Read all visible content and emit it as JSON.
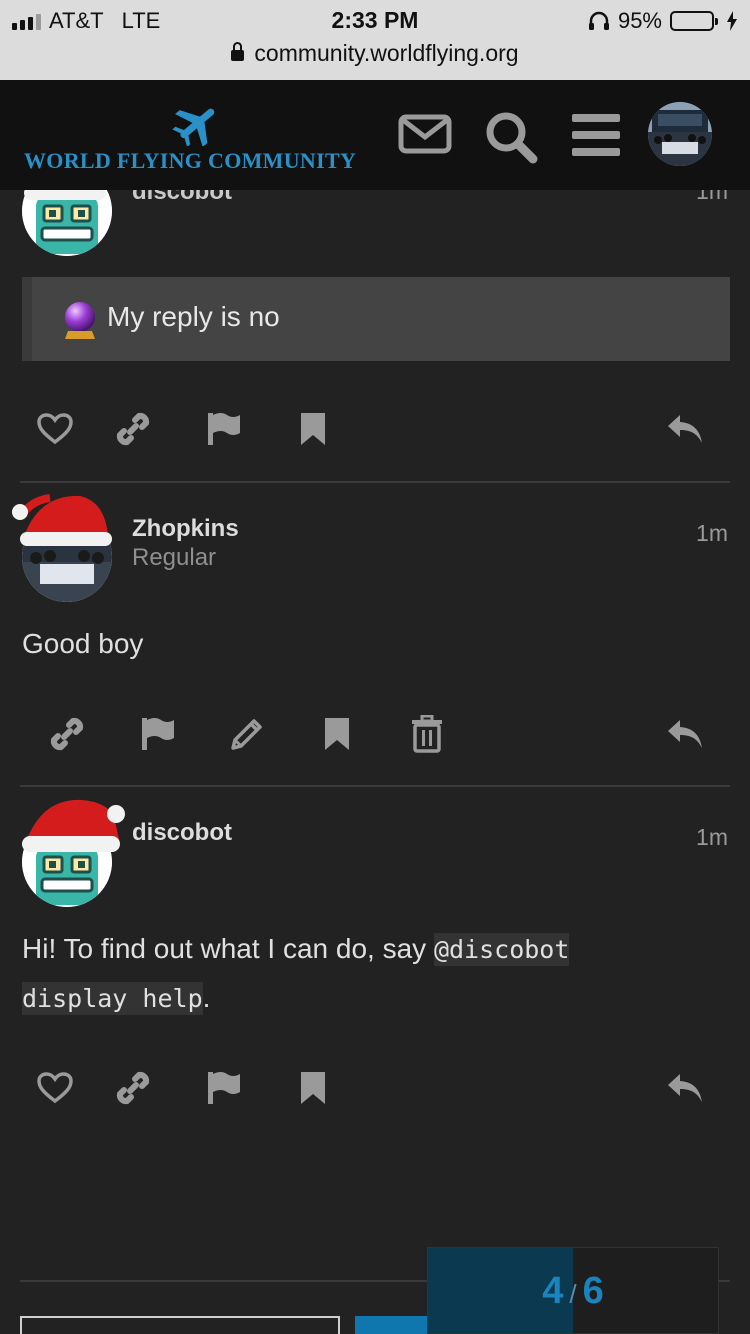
{
  "status_bar": {
    "carrier": "AT&T",
    "network": "LTE",
    "time": "2:33 PM",
    "battery": "95%",
    "battery_level": 0.95,
    "url": "community.worldflying.org"
  },
  "header": {
    "logo_text": "WORLD FLYING COMMUNITY",
    "icons": [
      "mail-icon",
      "search-icon",
      "hamburger-menu-icon",
      "user-avatar"
    ]
  },
  "posts": [
    {
      "author": "discobot",
      "time": "1m",
      "quote": "My reply is no",
      "actions": [
        "like",
        "link",
        "flag",
        "bookmark",
        "reply"
      ]
    },
    {
      "author": "Zhopkins",
      "title": "Regular",
      "time": "1m",
      "body": "Good boy",
      "actions": [
        "link",
        "flag",
        "edit",
        "bookmark",
        "delete",
        "reply"
      ]
    },
    {
      "author": "discobot",
      "time": "1m",
      "body_prefix": "Hi! To find out what I can do, say ",
      "body_code_1": "@discobot",
      "body_code_2": "display help",
      "body_suffix": ".",
      "actions": [
        "like",
        "link",
        "flag",
        "bookmark",
        "reply"
      ]
    }
  ],
  "progress": {
    "current": "4",
    "total": "6",
    "fraction": 0.5
  },
  "colors": {
    "background": "#222222",
    "header": "#111111",
    "accent": "#1a84bf",
    "quote_bg": "#444444"
  }
}
